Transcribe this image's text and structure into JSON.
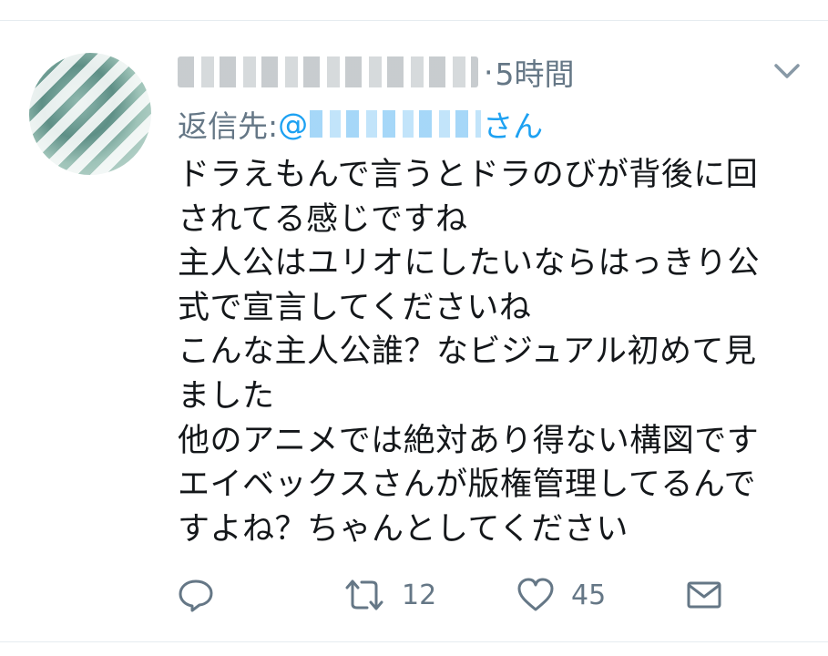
{
  "tweet": {
    "author_display": "",
    "timestamp_prefix": "· ",
    "timestamp": "5時間",
    "reply_to_label": "返信先: ",
    "reply_to_at": "@",
    "reply_to_handle_suffix": "さん",
    "lines": [
      "ドラえもんで言うとドラのびが背後に回",
      "されてる感じですね",
      "主人公はユリオにしたいならはっきり公",
      "式で宣言してくださいね",
      "こんな主人公誰？なビジュアル初めて見",
      "ました",
      "他のアニメでは絶対あり得ない構図です",
      "エイベックスさんが版権管理してるんで",
      "すよね？ちゃんとしてください"
    ]
  },
  "actions": {
    "reply_icon": "reply-icon",
    "retweet_icon": "retweet-icon",
    "retweet_count": "12",
    "like_icon": "heart-icon",
    "like_count": "45",
    "message_icon": "envelope-icon"
  },
  "colors": {
    "text": "#14171a",
    "secondary": "#657786",
    "link": "#1da1f2",
    "divider": "#e6ecf0"
  }
}
